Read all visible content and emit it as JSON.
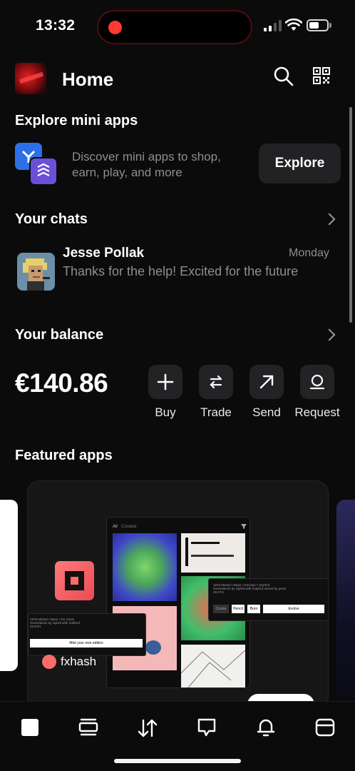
{
  "status_bar": {
    "time": "13:32"
  },
  "header": {
    "title": "Home"
  },
  "explore": {
    "title": "Explore mini apps",
    "description": "Discover mini apps to shop, earn, play, and more",
    "button_label": "Explore"
  },
  "chats": {
    "title": "Your chats",
    "items": [
      {
        "name": "Jesse Pollak",
        "time": "Monday",
        "message": "Thanks for the help! Excited for the future"
      }
    ]
  },
  "balance": {
    "title": "Your balance",
    "amount": "€140.86",
    "actions": [
      {
        "label": "Buy",
        "icon": "plus-icon"
      },
      {
        "label": "Trade",
        "icon": "swap-icon"
      },
      {
        "label": "Send",
        "icon": "arrow-up-right-icon"
      },
      {
        "label": "Request",
        "icon": "request-icon"
      }
    ]
  },
  "featured": {
    "title": "Featured apps",
    "card": {
      "app_name": "fxhash",
      "preview": {
        "tabs": [
          "All",
          "Curated"
        ],
        "mint_button": "Mint your own edition",
        "actions": [
          "Curate",
          "Pencil",
          "Burn",
          "Evolve"
        ]
      }
    }
  },
  "tab_bar": {
    "items": [
      {
        "icon": "home-icon",
        "active": true
      },
      {
        "icon": "stack-icon",
        "active": false
      },
      {
        "icon": "transfer-icon",
        "active": false
      },
      {
        "icon": "chat-icon",
        "active": false
      },
      {
        "icon": "bell-icon",
        "active": false
      },
      {
        "icon": "browser-icon",
        "active": false
      }
    ]
  },
  "colors": {
    "background": "#0b0b0c",
    "surface": "#232325",
    "muted_text": "#8e8e93",
    "accent_red": "#ff3b30"
  }
}
